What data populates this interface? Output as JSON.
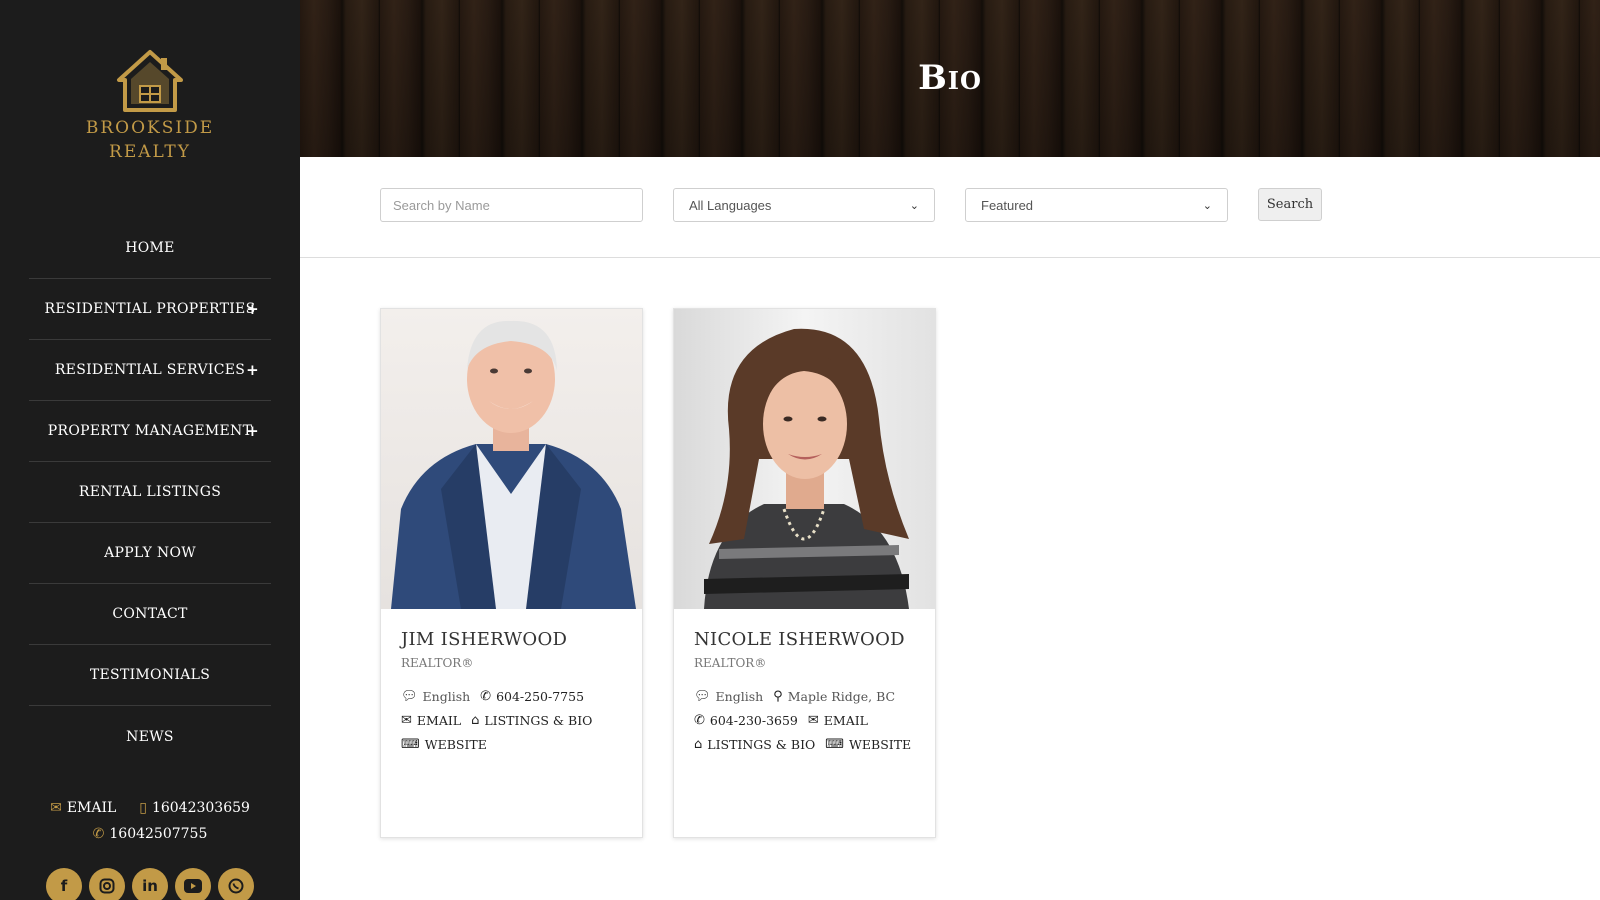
{
  "brand": {
    "line1": "BROOKSIDE",
    "line2": "REALTY",
    "color": "#c29a47"
  },
  "nav": {
    "items": [
      {
        "label": "HOME",
        "expandable": false
      },
      {
        "label": "RESIDENTIAL PROPERTIES",
        "expandable": true
      },
      {
        "label": "RESIDENTIAL SERVICES",
        "expandable": true
      },
      {
        "label": "PROPERTY MANAGEMENT",
        "expandable": true
      },
      {
        "label": "RENTAL LISTINGS",
        "expandable": false
      },
      {
        "label": "APPLY NOW",
        "expandable": false
      },
      {
        "label": "CONTACT",
        "expandable": false
      },
      {
        "label": "TESTIMONIALS",
        "expandable": false
      },
      {
        "label": "NEWS",
        "expandable": false
      }
    ],
    "expand_symbol": "+"
  },
  "sidebar_contact": {
    "email_label": "EMAIL",
    "mobile": "16042303659",
    "phone": "16042507755"
  },
  "socials": [
    "facebook-icon",
    "instagram-icon",
    "linkedin-icon",
    "youtube-icon",
    "whatsapp-icon"
  ],
  "hero": {
    "title": "Bio"
  },
  "search": {
    "name_placeholder": "Search by Name",
    "language_selected": "All Languages",
    "sort_selected": "Featured",
    "button_label": "Search"
  },
  "agents": [
    {
      "name": "JIM ISHERWOOD",
      "title": "REALTOR®",
      "language": "English",
      "phone": "604-250-7755",
      "email_label": "EMAIL",
      "listings_label": "LISTINGS & BIO",
      "website_label": "WEBSITE"
    },
    {
      "name": "NICOLE ISHERWOOD",
      "title": "REALTOR®",
      "language": "English",
      "location": "Maple Ridge, BC",
      "phone": "604-230-3659",
      "email_label": "EMAIL",
      "listings_label": "LISTINGS & BIO",
      "website_label": "WEBSITE"
    }
  ]
}
